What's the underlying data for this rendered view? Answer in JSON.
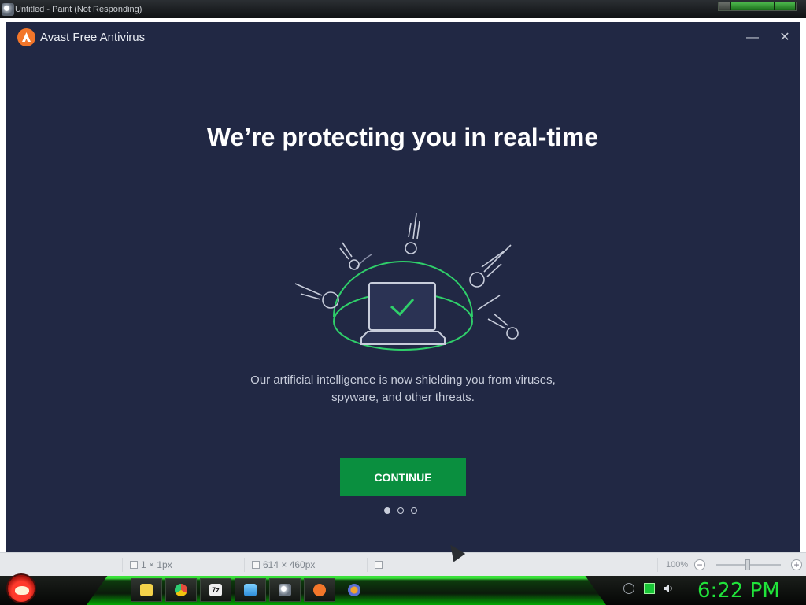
{
  "paint": {
    "window_title": "Untitled - Paint (Not Responding)",
    "status": {
      "selection_size": "1 × 1px",
      "image_size": "614 × 460px",
      "zoom": "100%"
    }
  },
  "avast": {
    "app_title": "Avast Free Antivirus",
    "minimize_glyph": "—",
    "close_glyph": "✕",
    "headline": "We’re protecting you in real-time",
    "subtext_line1": "Our artificial intelligence is now shielding you from viruses,",
    "subtext_line2": "spyware, and other threats.",
    "continue_label": "CONTINUE",
    "pager_pages": 3,
    "pager_active": 1,
    "colors": {
      "background": "#212844",
      "accent_green": "#0a8f3f",
      "shield_green": "#2fcf6a",
      "brand_orange": "#f3762a"
    }
  },
  "taskbar": {
    "clock": "6:22 PM",
    "apps": [
      "folder-icon",
      "chrome-icon",
      "7zip-icon",
      "monitor-app-icon",
      "paint-icon",
      "avast-icon",
      "avast-secure-browser-icon"
    ],
    "tray": [
      "keyboard-icon",
      "network-icon",
      "volume-icon"
    ],
    "accent": "#20e33a"
  }
}
